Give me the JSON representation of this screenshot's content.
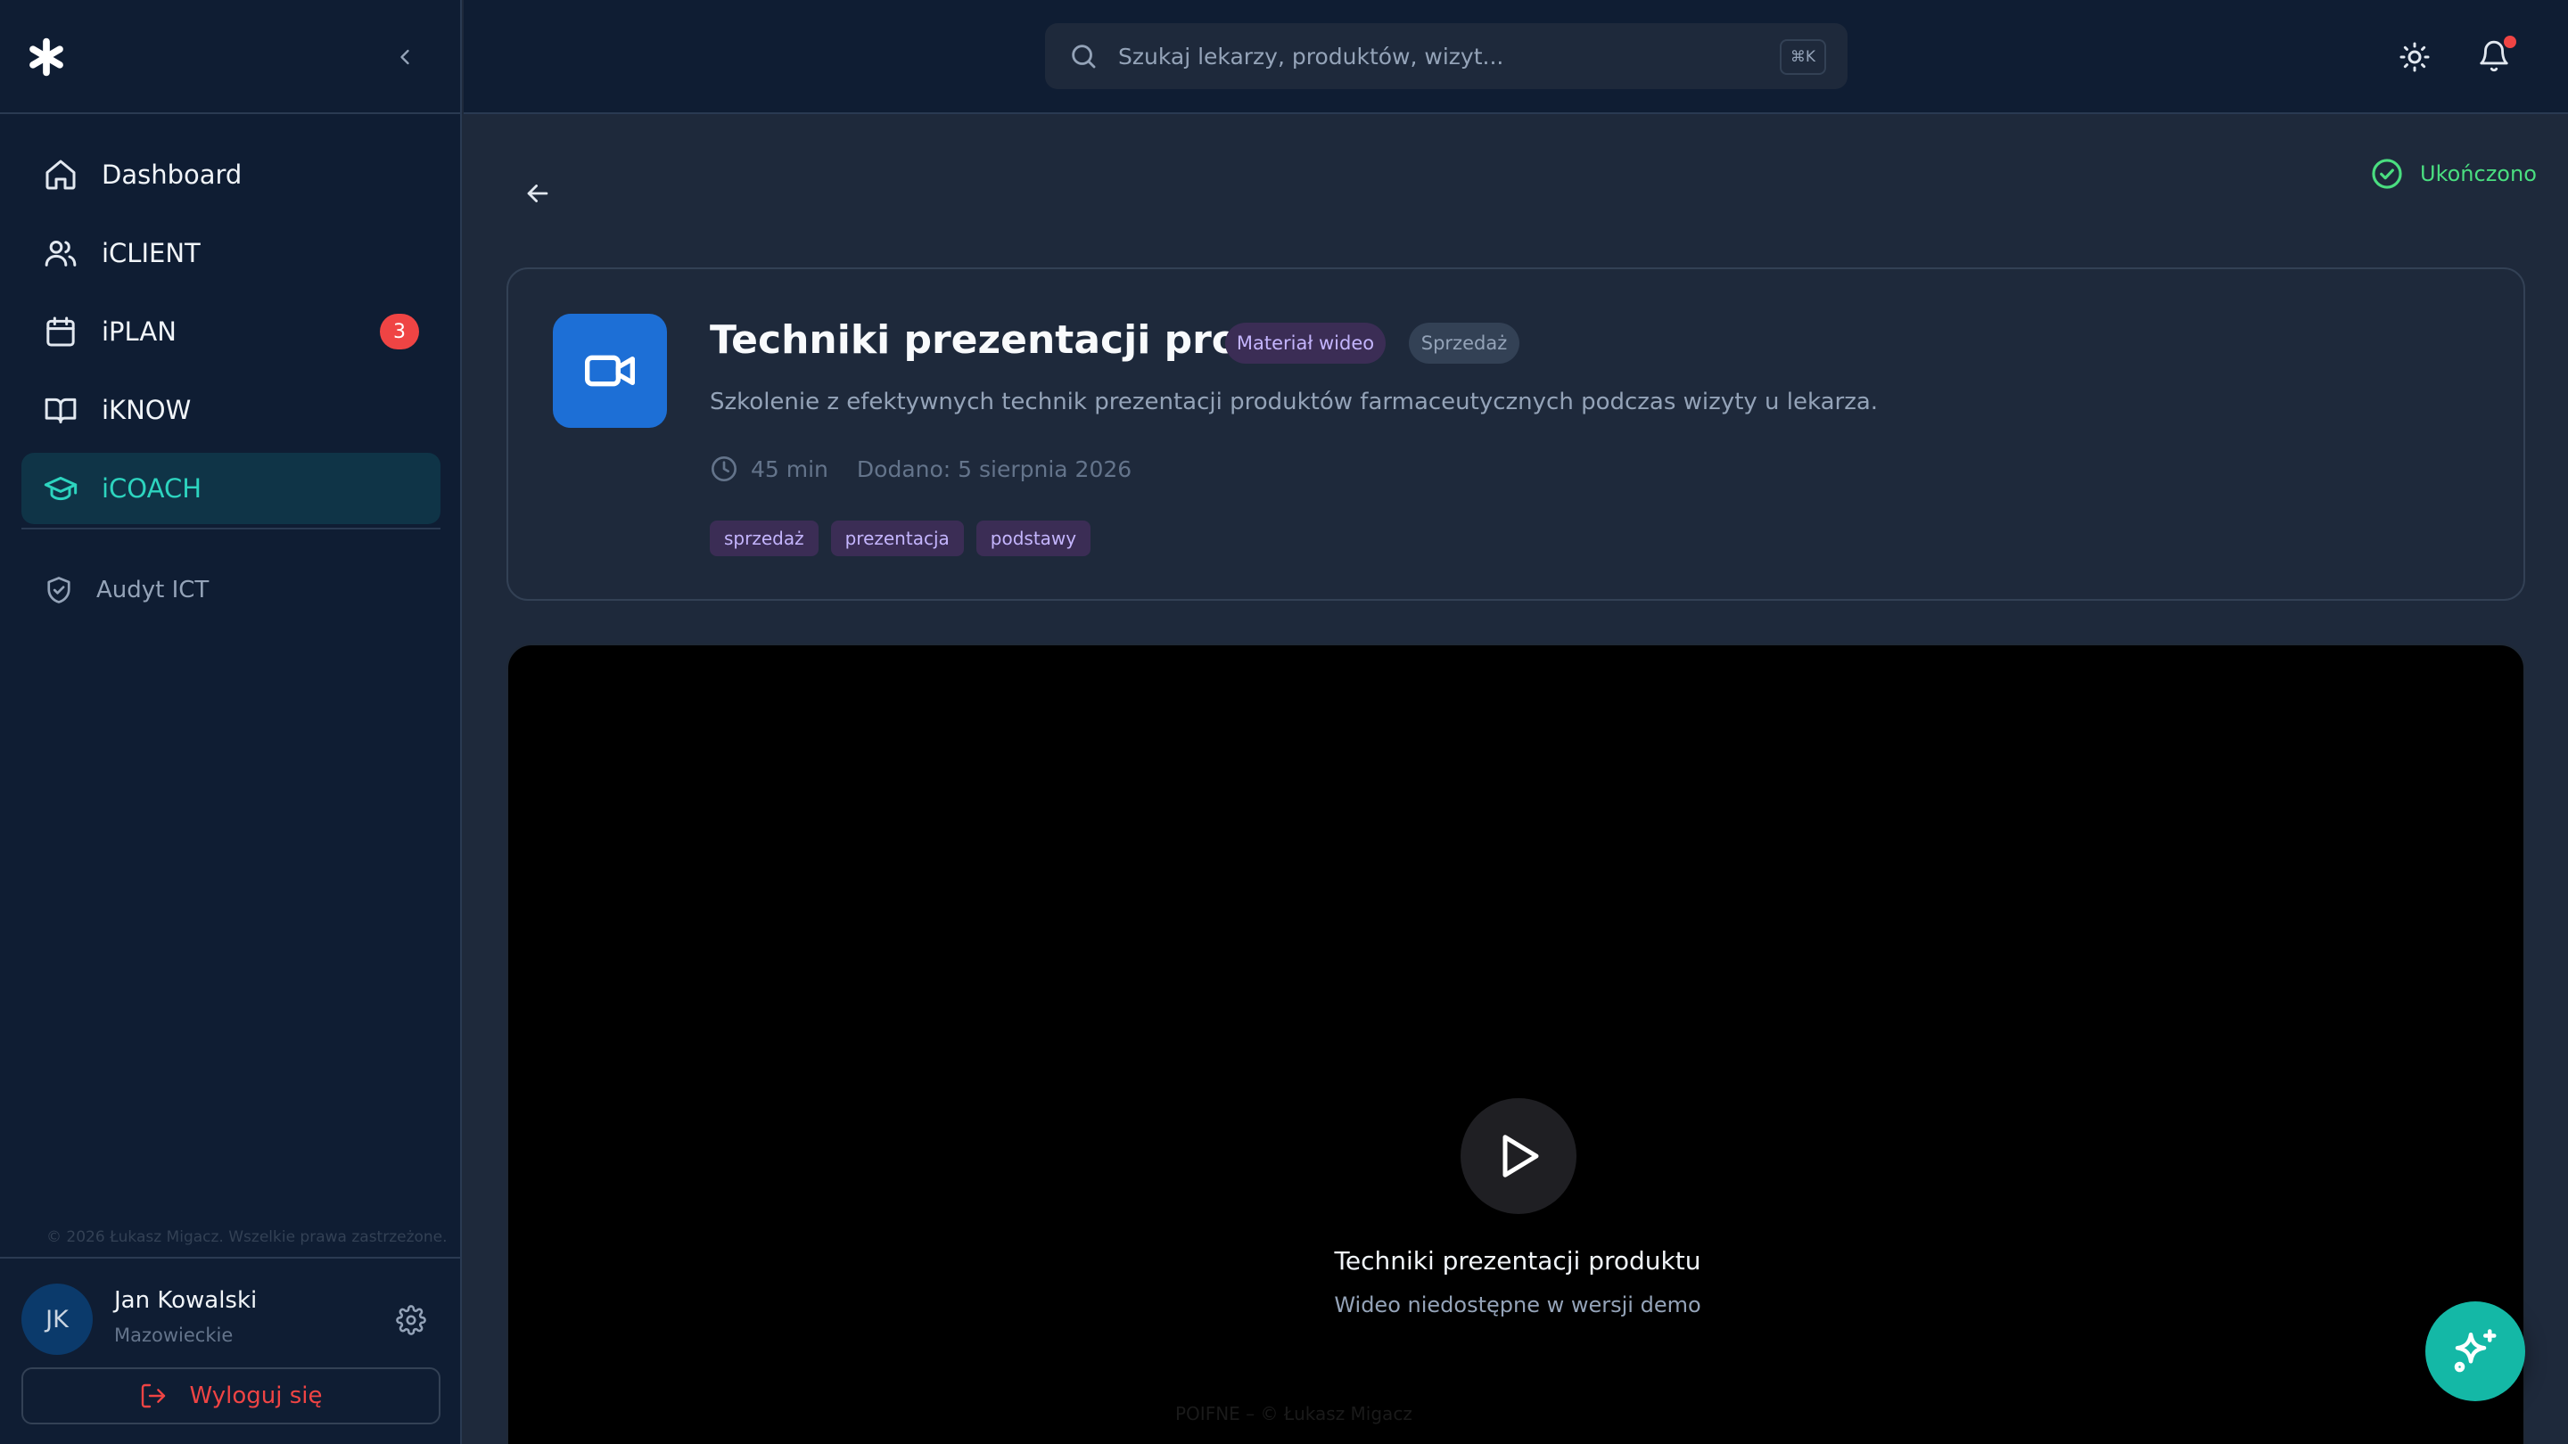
{
  "sidebar": {
    "logo_icon": "asterisk-logo-icon",
    "collapse_icon": "chevron-left-icon",
    "items": [
      {
        "label": "Dashboard",
        "icon": "home-icon"
      },
      {
        "label": "iCLIENT",
        "icon": "users-icon"
      },
      {
        "label": "iPLAN",
        "icon": "calendar-icon",
        "badge": "3"
      },
      {
        "label": "iKNOW",
        "icon": "book-open-icon"
      },
      {
        "label": "iCOACH",
        "icon": "graduation-cap-icon",
        "active": true
      }
    ],
    "secondary_item": {
      "label": "Audyt ICT",
      "icon": "shield-check-icon"
    },
    "copyright": "© 2026 Łukasz Migacz. Wszelkie prawa zastrzeżone.",
    "user": {
      "initials": "JK",
      "name": "Jan Kowalski",
      "region": "Mazowieckie",
      "settings_icon": "gear-icon"
    },
    "logout_label": "Wyloguj się"
  },
  "header": {
    "search_placeholder": "Szukaj lekarzy, produktów, wizyt...",
    "search_shortcut": "⌘K",
    "theme_icon": "sun-icon",
    "notifications_icon": "bell-icon"
  },
  "page": {
    "status_label": "Ukończono",
    "back_icon": "arrow-left-icon",
    "material": {
      "icon": "video-camera-icon",
      "title": "Techniki prezentacji produktu",
      "type_badge": "Materiał wideo",
      "category_badge": "Sprzedaż",
      "description": "Szkolenie z efektywnych technik prezentacji produktów farmaceutycznych podczas wizyty u lekarza.",
      "duration": "45 min",
      "added": "Dodano: 5 sierpnia 2026",
      "tags": [
        "sprzedaż",
        "prezentacja",
        "podstawy"
      ]
    },
    "video": {
      "title": "Techniki prezentacji produktu",
      "note": "Wideo niedostępne w wersji demo",
      "footer": "POIFNE – © Łukasz Migacz"
    }
  },
  "colors": {
    "accent": "#2dd4bf",
    "primary_blue": "#1d6fd6",
    "danger": "#ef4444",
    "success": "#4ade80"
  }
}
